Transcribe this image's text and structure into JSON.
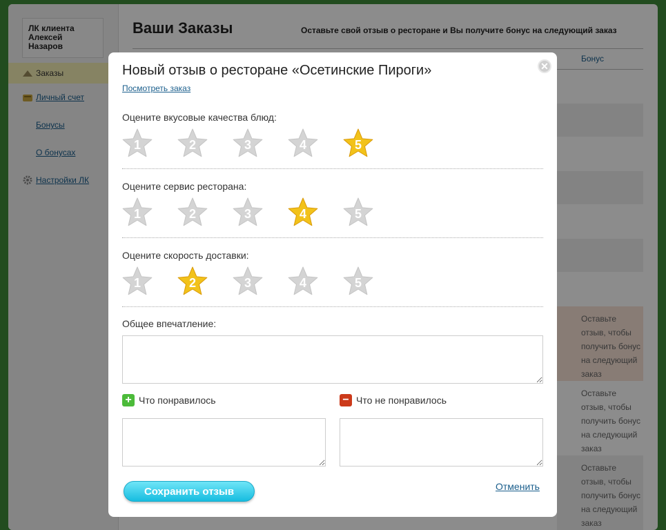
{
  "sidebar": {
    "client": [
      "ЛК клиента",
      "Алексей",
      "Назаров"
    ],
    "items": [
      {
        "label": "Заказы",
        "icon": "orders-icon"
      },
      {
        "label": "Личный счет",
        "icon": "wallet-icon"
      },
      {
        "label": "Бонусы"
      },
      {
        "label": "О бонусах"
      },
      {
        "label": "Настройки ЛК",
        "icon": "gear-icon"
      }
    ]
  },
  "main": {
    "title": "Ваши Заказы",
    "subtitle": "Оставьте свой отзыв о ресторане и Вы получите бонус на следующий заказ",
    "bonus_header": "Бонус",
    "bonus_text": "Оставьте отзыв, чтобы получить бонус на следующий заказ"
  },
  "modal": {
    "title": "Новый отзыв о ресторане «Осетинские Пироги»",
    "view_order": "Посмотреть заказ",
    "questions": [
      {
        "label": "Оцените вкусовые качества блюд:",
        "rating": 5
      },
      {
        "label": "Оцените сервис ресторана:",
        "rating": 4
      },
      {
        "label": "Оцените скорость доставки:",
        "rating": 2
      }
    ],
    "star_numbers": [
      "1",
      "2",
      "3",
      "4",
      "5"
    ],
    "overall_label": "Общее впечатление:",
    "liked_label": "Что понравилось",
    "disliked_label": "Что не понравилось",
    "save_button": "Сохранить отзыв",
    "cancel_link": "Отменить",
    "close_glyph": "✕"
  },
  "colors": {
    "star_active": "#f2c21a",
    "star_inactive": "#d4d4d4",
    "plus_icon": "#4cbb3a",
    "minus_icon": "#cc3a1a"
  }
}
